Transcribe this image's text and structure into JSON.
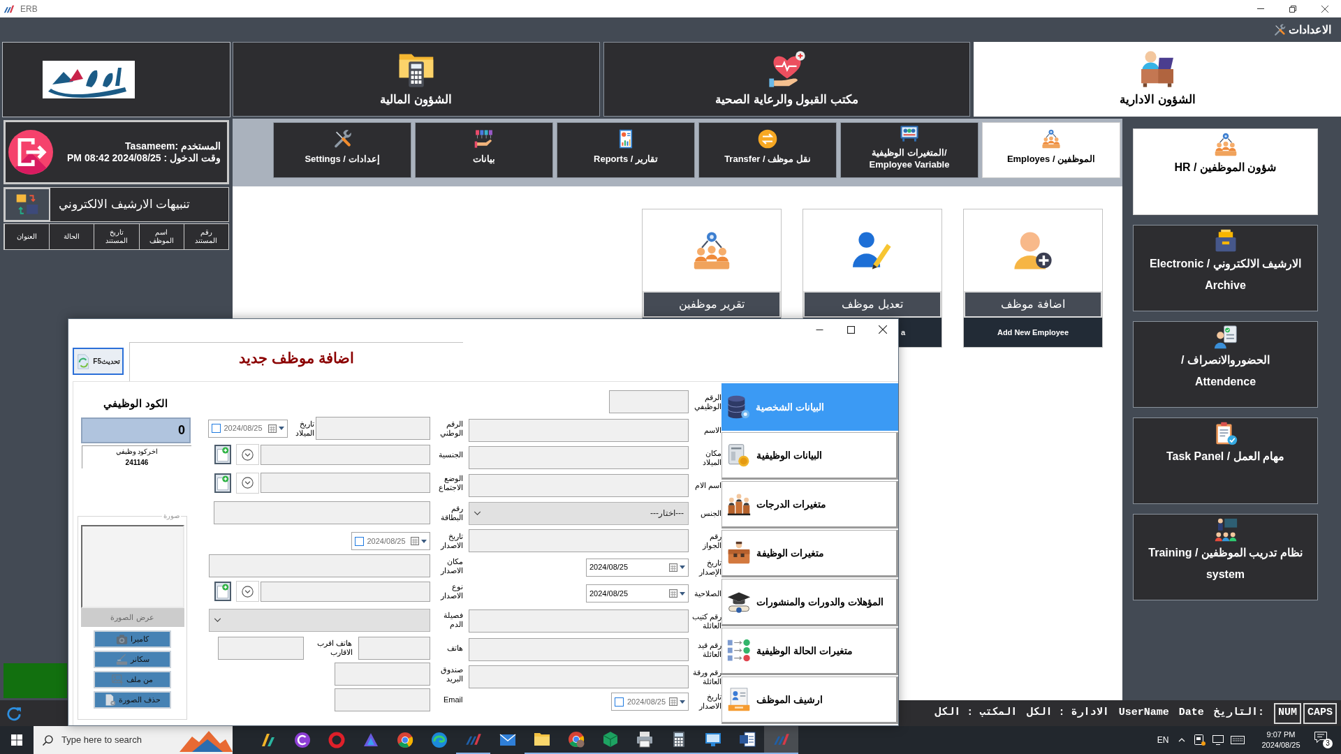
{
  "window": {
    "title": "ERB"
  },
  "top_bar": {
    "settings": "الاعدادات"
  },
  "modules": [
    {
      "label": "الشؤون الادارية",
      "kind": "hr",
      "selected": true
    },
    {
      "label": "مكتب القبول والرعاية الصحية",
      "kind": "health",
      "selected": false
    },
    {
      "label": "الشؤون المالية",
      "kind": "finance",
      "selected": false
    }
  ],
  "user_panel": {
    "user": "Tasameem: المستخدم",
    "login_time": "PM 08:42 2024/08/25 : وقت الدخول"
  },
  "archive_alerts": {
    "title": "تنبيهات الارشيف الالكتروني",
    "columns": [
      "رقم المستند",
      "اسم الموظف",
      "تاريخ المستند",
      "الحالة",
      "العنوان"
    ]
  },
  "subtabs": [
    {
      "label": "Employes / الموظفين",
      "kind": "employees",
      "selected": true
    },
    {
      "label": "المتغيرات الوظيفية/ Employee Variable",
      "kind": "variables",
      "selected": false
    },
    {
      "label": "Transfer / نقل موظف",
      "kind": "transfer",
      "selected": false
    },
    {
      "label": "Reports / تقارير",
      "kind": "reports",
      "selected": false
    },
    {
      "label": "بيانات",
      "kind": "data",
      "selected": false
    },
    {
      "label": "Settings / إعدادات",
      "kind": "settings",
      "selected": false
    }
  ],
  "employee_cards": [
    {
      "title": "اضافة موظف",
      "subtitle": "Add New Employee",
      "kind": "add"
    },
    {
      "title": "تعديل موظف",
      "subtitle": "a",
      "kind": "edit"
    },
    {
      "title": "تقرير موظفين",
      "kind": "report"
    }
  ],
  "sidebar": [
    {
      "label": "شؤون الموظفين / HR",
      "kind": "hr",
      "selected": true
    },
    {
      "label": "الارشيف الالكتروني / Electronic\nArchive",
      "kind": "archive",
      "selected": false
    },
    {
      "label": "الحضوروالانصراف /\nAttendence",
      "kind": "attendance",
      "selected": false
    },
    {
      "label": "مهام العمل / Task Panel",
      "kind": "tasks",
      "selected": false
    },
    {
      "label": "نظام تدريب الموظفين / Training\nsystem",
      "kind": "training",
      "selected": false
    }
  ],
  "dialog": {
    "refresh": "تحديثF5",
    "title": "اضافة موظف جديد",
    "code_label": "الكود الوظيفي",
    "code_value": "0",
    "last_code_label": "اخركود وظيفي",
    "last_code_value": "241146",
    "photo": {
      "legend": "صورة",
      "show": "عرض الصورة",
      "buttons": [
        {
          "label": "كاميرا",
          "kind": "camera"
        },
        {
          "label": "سكانر",
          "kind": "scanner"
        },
        {
          "label": "من ملف",
          "kind": "file"
        },
        {
          "label": "حذف الصورة",
          "kind": "delete"
        }
      ]
    },
    "fields_right": [
      {
        "label": "الرقم الوظيفي",
        "kind": "text"
      },
      {
        "label": "الاسم",
        "kind": "text"
      },
      {
        "label": "مكان الميلاد",
        "kind": "text"
      },
      {
        "label": "اسم الام",
        "kind": "text"
      },
      {
        "label": "الجنس",
        "kind": "select",
        "value": "---اختار---"
      },
      {
        "label": "رقم الجواز",
        "kind": "text"
      },
      {
        "label": "تاريخ الإصدار",
        "kind": "date",
        "value": "2024/08/25"
      },
      {
        "label": "الصلاحية",
        "kind": "date",
        "value": "2024/08/25"
      },
      {
        "label": "رقم كتيب العائلة",
        "kind": "text"
      },
      {
        "label": "رقم قيد العائلة",
        "kind": "text"
      },
      {
        "label": "رقم ورقة العائلة",
        "kind": "text"
      },
      {
        "label": "تاريخ الاصدار",
        "kind": "optional_date",
        "value": "2024/08/25",
        "checked": false
      }
    ],
    "fields_left": [
      [
        {
          "label": "الرقم الوطني",
          "kind": "text"
        },
        {
          "label": "تاريخ الميلاد",
          "kind": "optional_date",
          "value": "2024/08/25",
          "checked": false
        }
      ],
      [
        {
          "label": "الجنسية",
          "kind": "lookup"
        }
      ],
      [
        {
          "label": "الوضع الاجتماع",
          "kind": "lookup"
        }
      ],
      [
        {
          "label": "رقم البطاقة",
          "kind": "text"
        }
      ],
      [
        {
          "label": "تاريخ الاصدار",
          "kind": "optional_date",
          "value": "2024/08/25",
          "checked": false
        }
      ],
      [
        {
          "label": "مكان الاصدار",
          "kind": "text"
        }
      ],
      [
        {
          "label": "نوع الاصدار",
          "kind": "lookup"
        }
      ],
      [
        {
          "label": "فصيلة الدم",
          "kind": "select"
        }
      ],
      [
        {
          "label": "هاتف",
          "kind": "text"
        },
        {
          "label": "هاتف اقرب الاقارب",
          "kind": "text"
        }
      ],
      [
        {
          "label": "صندوق البريد",
          "kind": "text"
        }
      ],
      [
        {
          "label": "Email",
          "kind": "text"
        }
      ]
    ],
    "tabs": [
      {
        "label": "البيانات الشخصية",
        "kind": "personal",
        "selected": true
      },
      {
        "label": "البيانات الوظيفية",
        "kind": "job",
        "selected": false
      },
      {
        "label": "متغيرات الدرجات",
        "kind": "grades",
        "selected": false
      },
      {
        "label": "متغيرات الوظيفة",
        "kind": "job_variables",
        "selected": false
      },
      {
        "label": "المؤهلات والدورات والمنشورات",
        "kind": "qualifications",
        "selected": false
      },
      {
        "label": "متغيرات الحالة الوظيفية",
        "kind": "job_status",
        "selected": false
      },
      {
        "label": "ارشيف الموظف",
        "kind": "archive",
        "selected": false
      }
    ]
  },
  "status_bar": {
    "keys": [
      "CAPS",
      "NUM"
    ],
    "items": [
      "التاريخ:",
      "Date",
      "UserName",
      "الادارة : الكل",
      "المكتب : الكل"
    ]
  },
  "taskbar": {
    "search_placeholder": "Type here to search",
    "apps": [
      {
        "kind": "slanted",
        "open": false,
        "active": false
      },
      {
        "kind": "circle_logo",
        "open": false,
        "active": false
      },
      {
        "kind": "ring",
        "open": false,
        "active": false
      },
      {
        "kind": "triangle",
        "open": false,
        "active": false
      },
      {
        "kind": "segments",
        "open": false,
        "active": false
      },
      {
        "kind": "swirl",
        "open": false,
        "active": false
      },
      {
        "kind": "bars",
        "open": true,
        "active": false
      },
      {
        "kind": "mail",
        "open": false,
        "active": false
      },
      {
        "kind": "folder",
        "open": true,
        "active": false
      },
      {
        "kind": "avatar_segments",
        "open": true,
        "active": false
      },
      {
        "kind": "cube",
        "open": true,
        "active": false
      },
      {
        "kind": "printer",
        "open": true,
        "active": false
      },
      {
        "kind": "calculator",
        "open": true,
        "active": false
      },
      {
        "kind": "monitor",
        "open": true,
        "active": false
      },
      {
        "kind": "document",
        "open": true,
        "active": false
      },
      {
        "kind": "bars",
        "open": true,
        "active": true
      }
    ],
    "language": "EN",
    "time": "9:07 PM",
    "date": "2024/08/25",
    "notifications": "3"
  }
}
